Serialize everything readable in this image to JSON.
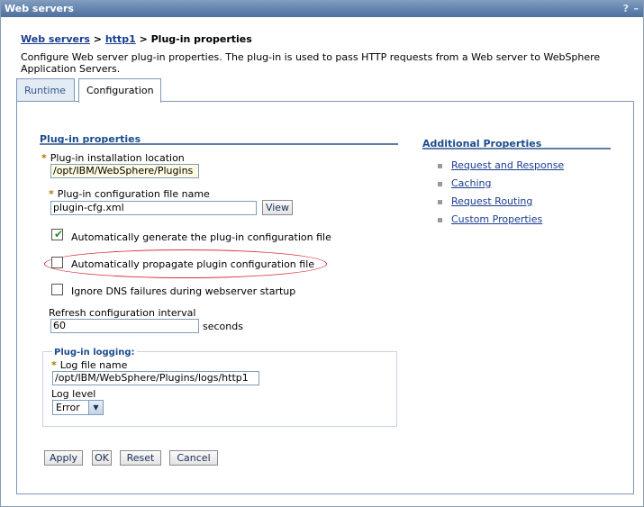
{
  "window": {
    "title": "Web servers",
    "help_glyph": "?",
    "minimize_glyph": "–"
  },
  "breadcrumb": {
    "link1": "Web servers",
    "sep1": " > ",
    "link2": "http1",
    "sep2": " > ",
    "current": "Plug-in properties"
  },
  "description": "Configure Web server plug-in properties. The plug-in is used to pass HTTP requests from a Web server to WebSphere Application Servers.",
  "tabs": [
    {
      "label": "Runtime"
    },
    {
      "label": "Configuration"
    }
  ],
  "plugin_properties": {
    "title": "Plug-in properties",
    "required_marker": "*",
    "install_location": {
      "label": "Plug-in installation location",
      "value": "/opt/IBM/WebSphere/Plugins"
    },
    "config_file": {
      "label": "Plug-in configuration file name",
      "value": "plugin-cfg.xml",
      "view_label": "View"
    },
    "auto_generate": {
      "label": "Automatically generate the plug-in configuration file",
      "checked": true
    },
    "auto_propagate": {
      "label": "Automatically propagate plugin configuration file",
      "checked": false
    },
    "ignore_dns": {
      "label": "Ignore DNS failures during webserver startup",
      "checked": false
    },
    "refresh": {
      "label": "Refresh configuration interval",
      "value": "60",
      "unit": "seconds"
    }
  },
  "logging": {
    "title": "Plug-in logging:",
    "log_file": {
      "label": "Log file name",
      "value": "/opt/IBM/WebSphere/Plugins/logs/http1"
    },
    "log_level": {
      "label": "Log level",
      "value": "Error"
    }
  },
  "buttons": {
    "apply": "Apply",
    "ok": "OK",
    "reset": "Reset",
    "cancel": "Cancel"
  },
  "additional": {
    "title": "Additional Properties",
    "links": [
      "Request and Response",
      "Caching",
      "Request Routing",
      "Custom Properties"
    ]
  },
  "colors": {
    "titlebar": "#5a7ba8",
    "link": "#1a3d8f",
    "highlight_ellipse": "#d9333f"
  }
}
